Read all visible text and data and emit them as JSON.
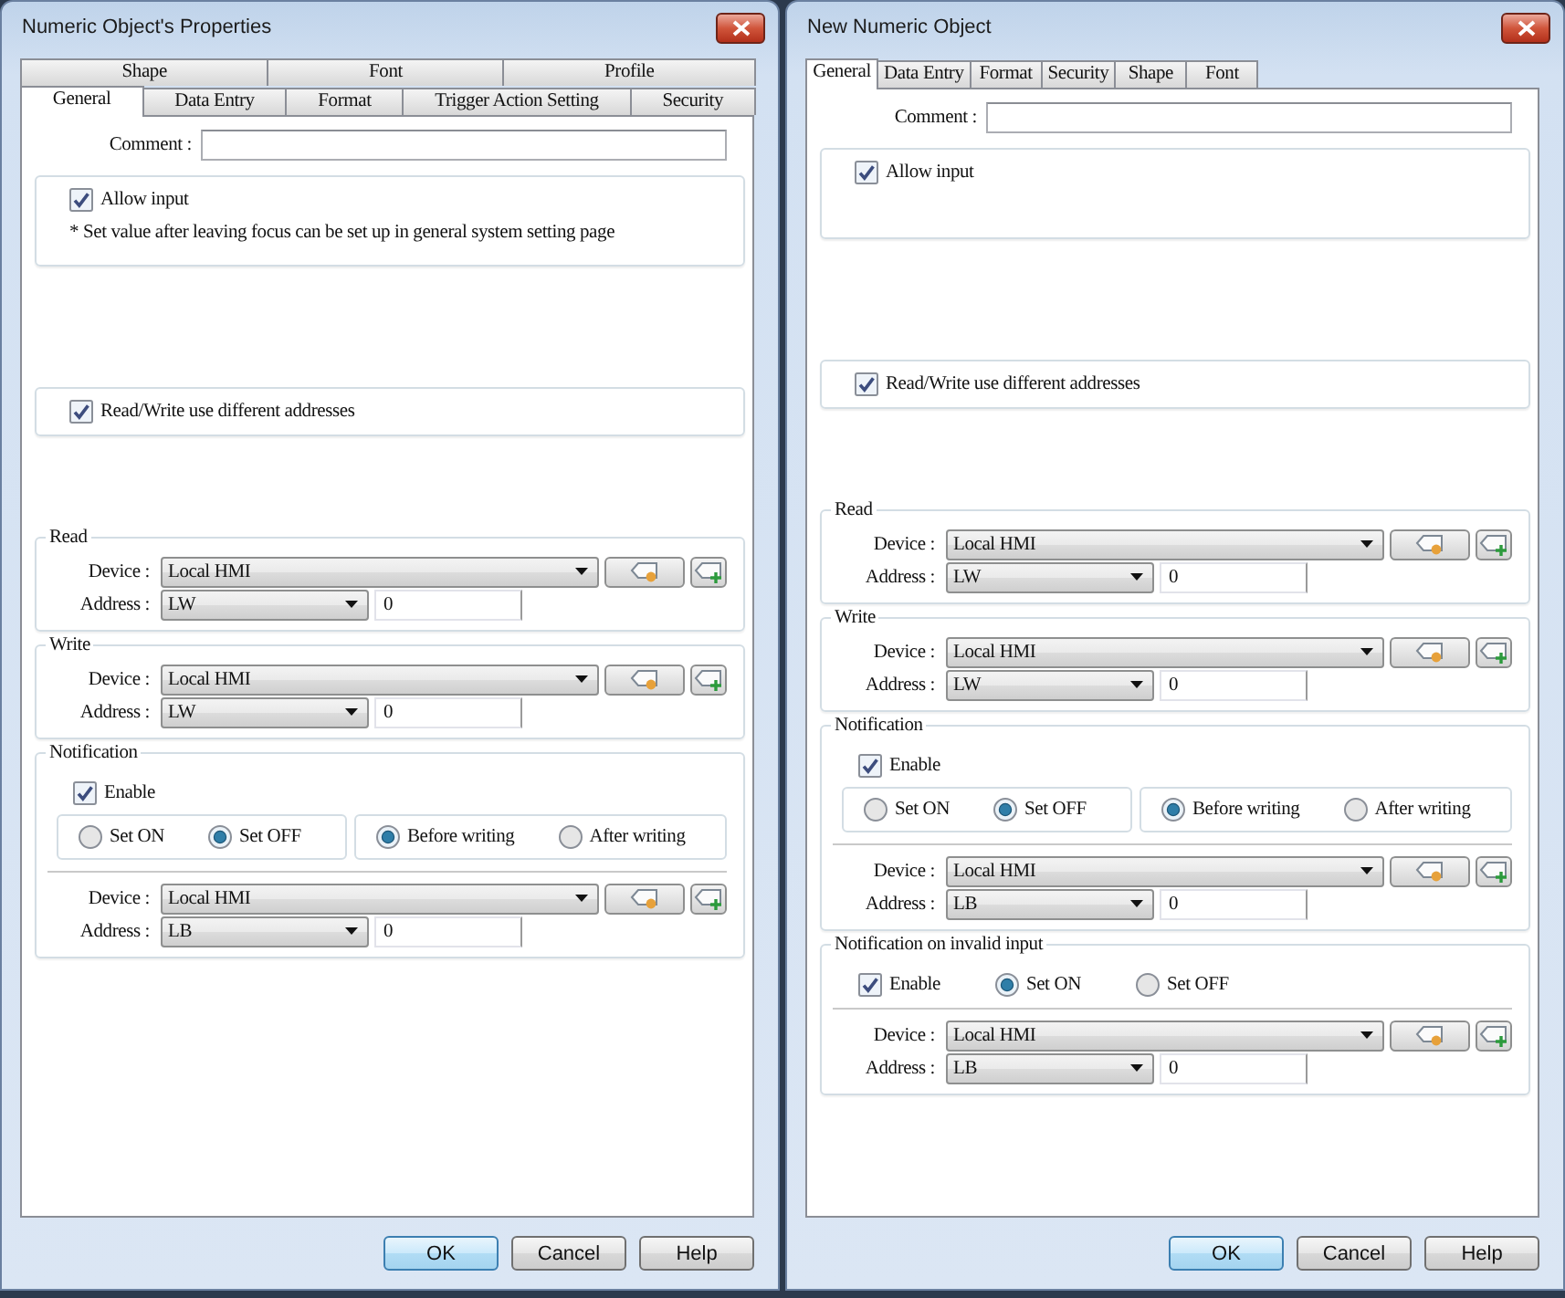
{
  "dialogs": [
    {
      "title": "Numeric Object's Properties",
      "tab_rows": [
        [
          {
            "label": "Shape",
            "selected": false
          },
          {
            "label": "Font",
            "selected": false
          },
          {
            "label": "Profile",
            "selected": false
          }
        ],
        [
          {
            "label": "General",
            "selected": true
          },
          {
            "label": "Data Entry",
            "selected": false
          },
          {
            "label": "Format",
            "selected": false
          },
          {
            "label": "Trigger Action Setting",
            "selected": false
          },
          {
            "label": "Security",
            "selected": false
          }
        ]
      ],
      "comment": {
        "label": "Comment :"
      },
      "sections": [
        {
          "kind": "option",
          "checkbox": {
            "label": "Allow input",
            "checked": true
          },
          "note": "* Set value after leaving focus can be set up in general system setting page"
        },
        {
          "kind": "option",
          "checkbox": {
            "label": "Read/Write use different addresses",
            "checked": true
          }
        },
        {
          "kind": "address",
          "title": "Read",
          "device": {
            "label": "Device :",
            "value": "Local HMI"
          },
          "address": {
            "label": "Address :",
            "value": "LW",
            "number": "0"
          }
        },
        {
          "kind": "address",
          "title": "Write",
          "device": {
            "label": "Device :",
            "value": "Local HMI"
          },
          "address": {
            "label": "Address :",
            "value": "LW",
            "number": "0"
          }
        },
        {
          "kind": "notification",
          "title": "Notification",
          "enable": {
            "label": "Enable",
            "checked": true
          },
          "radio_groups": [
            [
              {
                "label": "Set ON",
                "selected": false
              },
              {
                "label": "Set OFF",
                "selected": true
              }
            ],
            [
              {
                "label": "Before writing",
                "selected": true
              },
              {
                "label": "After writing",
                "selected": false
              }
            ]
          ],
          "device": {
            "label": "Device :",
            "value": "Local HMI"
          },
          "address": {
            "label": "Address :",
            "value": "LB",
            "number": "0"
          }
        }
      ],
      "buttons": [
        {
          "label": "OK",
          "default": true
        },
        {
          "label": "Cancel",
          "default": false
        },
        {
          "label": "Help",
          "default": false
        }
      ]
    },
    {
      "title": "New Numeric Object",
      "tab_rows": [
        [
          {
            "label": "General",
            "selected": true
          },
          {
            "label": "Data Entry",
            "selected": false
          },
          {
            "label": "Format",
            "selected": false
          },
          {
            "label": "Security",
            "selected": false
          },
          {
            "label": "Shape",
            "selected": false
          },
          {
            "label": "Font",
            "selected": false
          }
        ]
      ],
      "comment": {
        "label": "Comment :"
      },
      "sections": [
        {
          "kind": "option",
          "checkbox": {
            "label": "Allow input",
            "checked": true
          }
        },
        {
          "kind": "option",
          "checkbox": {
            "label": "Read/Write use different addresses",
            "checked": true
          }
        },
        {
          "kind": "address",
          "title": "Read",
          "device": {
            "label": "Device :",
            "value": "Local HMI"
          },
          "address": {
            "label": "Address :",
            "value": "LW",
            "number": "0"
          }
        },
        {
          "kind": "address",
          "title": "Write",
          "device": {
            "label": "Device :",
            "value": "Local HMI"
          },
          "address": {
            "label": "Address :",
            "value": "LW",
            "number": "0"
          }
        },
        {
          "kind": "notification",
          "title": "Notification",
          "enable": {
            "label": "Enable",
            "checked": true
          },
          "radio_groups": [
            [
              {
                "label": "Set ON",
                "selected": false
              },
              {
                "label": "Set OFF",
                "selected": true
              }
            ],
            [
              {
                "label": "Before writing",
                "selected": true
              },
              {
                "label": "After writing",
                "selected": false
              }
            ]
          ],
          "device": {
            "label": "Device :",
            "value": "Local HMI"
          },
          "address": {
            "label": "Address :",
            "value": "LB",
            "number": "0"
          }
        },
        {
          "kind": "invalid_input",
          "title": "Notification on invalid input",
          "enable": {
            "label": "Enable",
            "checked": true
          },
          "radios": [
            {
              "label": "Set ON",
              "selected": true
            },
            {
              "label": "Set OFF",
              "selected": false
            }
          ],
          "device": {
            "label": "Device :",
            "value": "Local HMI"
          },
          "address": {
            "label": "Address :",
            "value": "LB",
            "number": "0"
          }
        }
      ],
      "buttons": [
        {
          "label": "OK",
          "default": true
        },
        {
          "label": "Cancel",
          "default": false
        },
        {
          "label": "Help",
          "default": false
        }
      ]
    }
  ]
}
